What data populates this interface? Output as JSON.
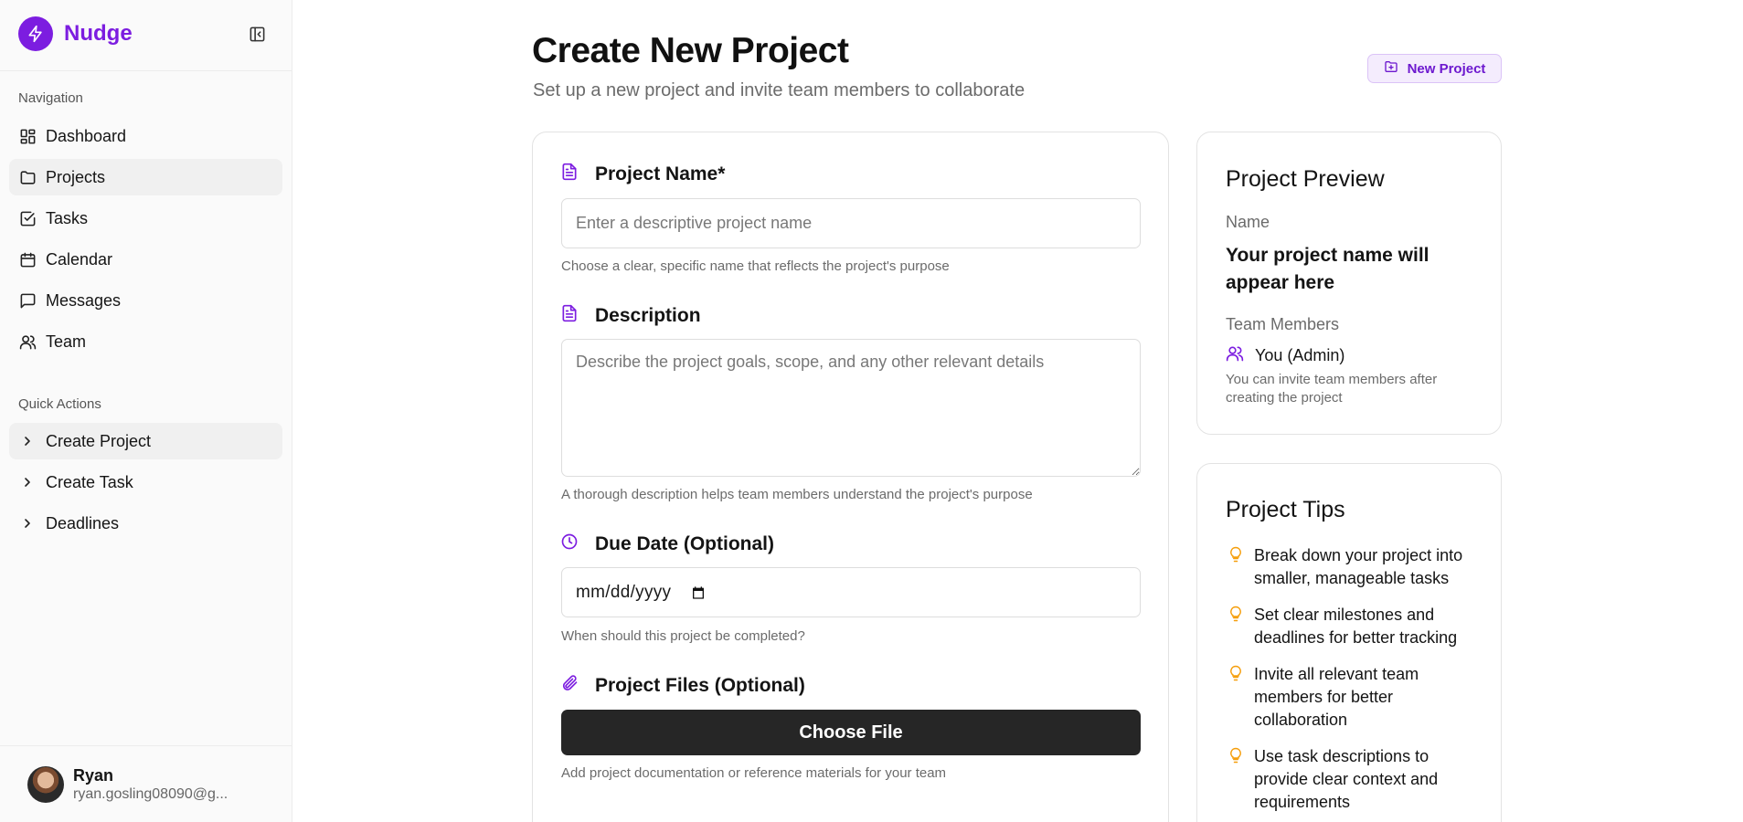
{
  "brand": {
    "name": "Nudge"
  },
  "sidebar": {
    "nav_heading": "Navigation",
    "nav_items": [
      {
        "label": "Dashboard",
        "icon": "dashboard-icon"
      },
      {
        "label": "Projects",
        "icon": "folder-icon",
        "active": true
      },
      {
        "label": "Tasks",
        "icon": "check-square-icon"
      },
      {
        "label": "Calendar",
        "icon": "calendar-icon"
      },
      {
        "label": "Messages",
        "icon": "message-icon"
      },
      {
        "label": "Team",
        "icon": "users-icon"
      }
    ],
    "quick_heading": "Quick Actions",
    "quick_items": [
      {
        "label": "Create Project",
        "icon": "chevron-right-icon",
        "active": true
      },
      {
        "label": "Create Task",
        "icon": "chevron-right-icon"
      },
      {
        "label": "Deadlines",
        "icon": "chevron-right-icon"
      }
    ],
    "user": {
      "name": "Ryan",
      "email": "ryan.gosling08090@g..."
    }
  },
  "header": {
    "title": "Create New Project",
    "subtitle": "Set up a new project and invite team members to collaborate",
    "badge_label": "New Project"
  },
  "form": {
    "name_label": "Project Name*",
    "name_placeholder": "Enter a descriptive project name",
    "name_hint": "Choose a clear, specific name that reflects the project's purpose",
    "description_label": "Description",
    "description_placeholder": "Describe the project goals, scope, and any other relevant details",
    "description_hint": "A thorough description helps team members understand the project's purpose",
    "due_label": "Due Date (Optional)",
    "due_value": "mm/dd/yyyy",
    "due_hint": "When should this project be completed?",
    "files_label": "Project Files (Optional)",
    "files_button": "Choose File",
    "files_hint": "Add project documentation or reference materials for your team"
  },
  "preview": {
    "title": "Project Preview",
    "name_label": "Name",
    "name_value": "Your project name will appear here",
    "members_label": "Team Members",
    "member": "You (Admin)",
    "note": "You can invite team members after creating the project"
  },
  "tips": {
    "title": "Project Tips",
    "items": [
      "Break down your project into smaller, manageable tasks",
      "Set clear milestones and deadlines for better tracking",
      "Invite all relevant team members for better collaboration",
      "Use task descriptions to provide clear context and requirements"
    ]
  },
  "colors": {
    "brand": "#7c1de0",
    "tip_bulb": "#f59e0b",
    "button_dark": "#262626"
  }
}
